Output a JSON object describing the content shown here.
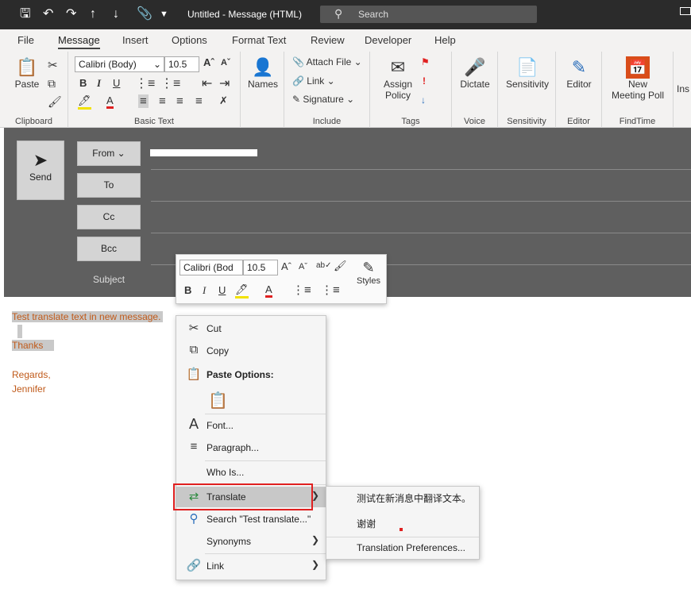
{
  "titlebar": {
    "title": "Untitled  -  Message (HTML)",
    "search_placeholder": "Search",
    "quick_access_icons": [
      "save-icon",
      "undo-icon",
      "redo-icon",
      "up-icon",
      "down-icon",
      "attach-icon",
      "customize-icon"
    ]
  },
  "menu": {
    "tabs": [
      "File",
      "Message",
      "Insert",
      "Options",
      "Format Text",
      "Review",
      "Developer",
      "Help"
    ],
    "active": "Message"
  },
  "ribbon": {
    "clipboard": {
      "paste": "Paste",
      "label": "Clipboard"
    },
    "basic_text": {
      "font": "Calibri (Body)",
      "size": "10.5",
      "label": "Basic Text"
    },
    "names": {
      "label": "Names"
    },
    "include": {
      "attach": "Attach File",
      "link": "Link",
      "signature": "Signature",
      "label": "Include"
    },
    "tags": {
      "assign": "Assign",
      "policy": "Policy",
      "label": "Tags"
    },
    "voice": {
      "dictate": "Dictate",
      "label": "Voice"
    },
    "sensitivity": {
      "btn": "Sensitivity",
      "label": "Sensitivity"
    },
    "editor": {
      "btn": "Editor",
      "label": "Editor"
    },
    "findtime": {
      "new": "New",
      "poll": "Meeting Poll",
      "label": "FindTime"
    },
    "insights": {
      "btn": "Ins"
    }
  },
  "compose": {
    "send": "Send",
    "from": "From",
    "to": "To",
    "cc": "Cc",
    "bcc": "Bcc",
    "subject": "Subject"
  },
  "mini_toolbar": {
    "font": "Calibri (Bod",
    "size": "10.5",
    "styles": "Styles"
  },
  "body": {
    "line1": "Test translate text in new message.",
    "line2": "Thanks",
    "line3": "Regards,",
    "line4": "Jennifer"
  },
  "context_menu": {
    "cut": "Cut",
    "copy": "Copy",
    "paste_options": "Paste Options:",
    "font": "Font...",
    "paragraph": "Paragraph...",
    "who_is": "Who Is...",
    "translate": "Translate",
    "search": "Search \"Test translate...\"",
    "synonyms": "Synonyms",
    "link": "Link"
  },
  "translate_submenu": {
    "result1": "测试在新消息中翻译文本。",
    "result2": "谢谢",
    "prefs": "Translation Preferences..."
  },
  "colors": {
    "accent_red": "#e02020",
    "body_text": "#c05a1a",
    "compose_bg": "#5f5f5f"
  }
}
